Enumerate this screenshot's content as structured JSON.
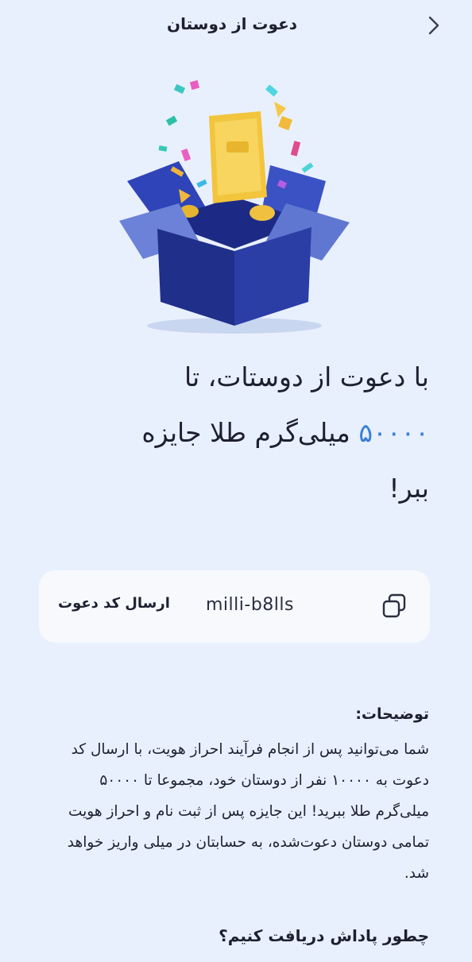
{
  "header": {
    "title": "دعوت از دوستان",
    "back_icon": "chevron-right-icon"
  },
  "hero": {
    "image": "gift-box-with-gold-bar-illustration"
  },
  "headline": {
    "part1": "با دعوت از دوستات، تا",
    "amount": "۵۰۰۰۰",
    "part2": "میلی‌گرم طلا جایزه",
    "part3": "ببر!"
  },
  "invite": {
    "copy_icon": "copy-icon",
    "code": "milli-b8lls",
    "send_label": "ارسال کد دعوت"
  },
  "description": {
    "title": "توضیحات:",
    "body": "شما می‌توانید پس از انجام فرآیند احراز هویت، با ارسال کد دعوت به ۱۰۰۰۰ نفر از دوستان خود، مجموعا تا ۵۰۰۰۰ میلی‌گرم طلا ببرید! این جایزه پس از ثبت نام و احراز هویت تمامی دوستان دعوت‌شده، به حسابتان در میلی واریز خواهد شد."
  },
  "how": {
    "title": "چطور پاداش دریافت کنیم؟"
  },
  "colors": {
    "background": "#e9f0fd",
    "accent": "#3a7fd8",
    "card": "#f7f9fd",
    "box_blue": "#22338f",
    "gold": "#f2c53d"
  }
}
